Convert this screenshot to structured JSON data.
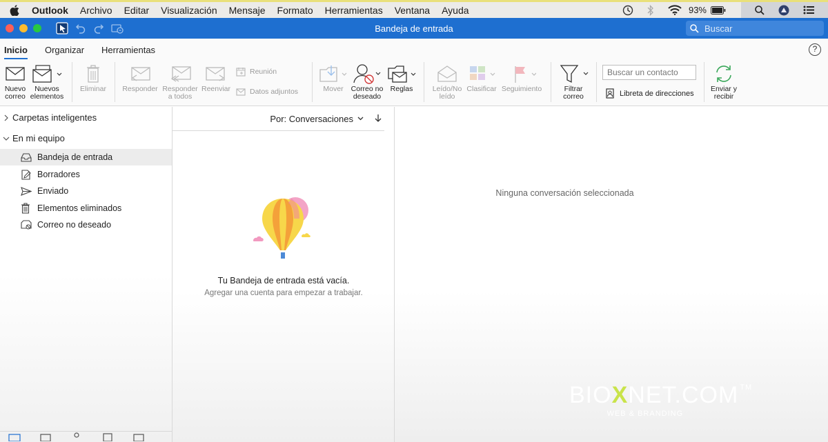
{
  "menubar": {
    "items": [
      "Outlook",
      "Archivo",
      "Editar",
      "Visualización",
      "Mensaje",
      "Formato",
      "Herramientas",
      "Ventana",
      "Ayuda"
    ],
    "battery": "93%"
  },
  "window": {
    "title": "Bandeja de entrada",
    "search_placeholder": "Buscar"
  },
  "tabs": [
    "Inicio",
    "Organizar",
    "Herramientas"
  ],
  "ribbon": {
    "new_mail": [
      "Nuevo",
      "correo"
    ],
    "new_items": [
      "Nuevos",
      "elementos"
    ],
    "delete": "Eliminar",
    "reply": "Responder",
    "reply_all": [
      "Responder",
      "a todos"
    ],
    "forward": "Reenviar",
    "meeting": "Reunión",
    "attachments": "Datos adjuntos",
    "move": "Mover",
    "junk": [
      "Correo no",
      "deseado"
    ],
    "rules": "Reglas",
    "read_unread": [
      "Leído/No",
      "leído"
    ],
    "categorize": "Clasificar",
    "follow_up": "Seguimiento",
    "filter": [
      "Filtrar",
      "correo"
    ],
    "contact_placeholder": "Buscar un contacto",
    "address_book": "Libreta de direcciones",
    "send_receive": [
      "Enviar y",
      "recibir"
    ]
  },
  "sidebar": {
    "groups": [
      "Carpetas inteligentes",
      "En mi equipo"
    ],
    "folders": [
      "Bandeja de entrada",
      "Borradores",
      "Enviado",
      "Elementos eliminados",
      "Correo no deseado"
    ]
  },
  "list": {
    "sort_label": "Por: Conversaciones",
    "empty_title": "Tu Bandeja de entrada está vacía.",
    "empty_subtitle": "Agregar una cuenta para empezar a trabajar."
  },
  "reading": {
    "empty": "Ninguna conversación seleccionada"
  },
  "watermark": {
    "main_a": "BIO",
    "main_x": "X",
    "main_b": "NET.COM",
    "tm": "TM",
    "sub": "WEB & BRANDING"
  },
  "colors": {
    "accent": "#1e6fd0",
    "traffic_red": "#fc5f57",
    "traffic_yellow": "#fdbc2e",
    "traffic_green": "#28c840"
  }
}
